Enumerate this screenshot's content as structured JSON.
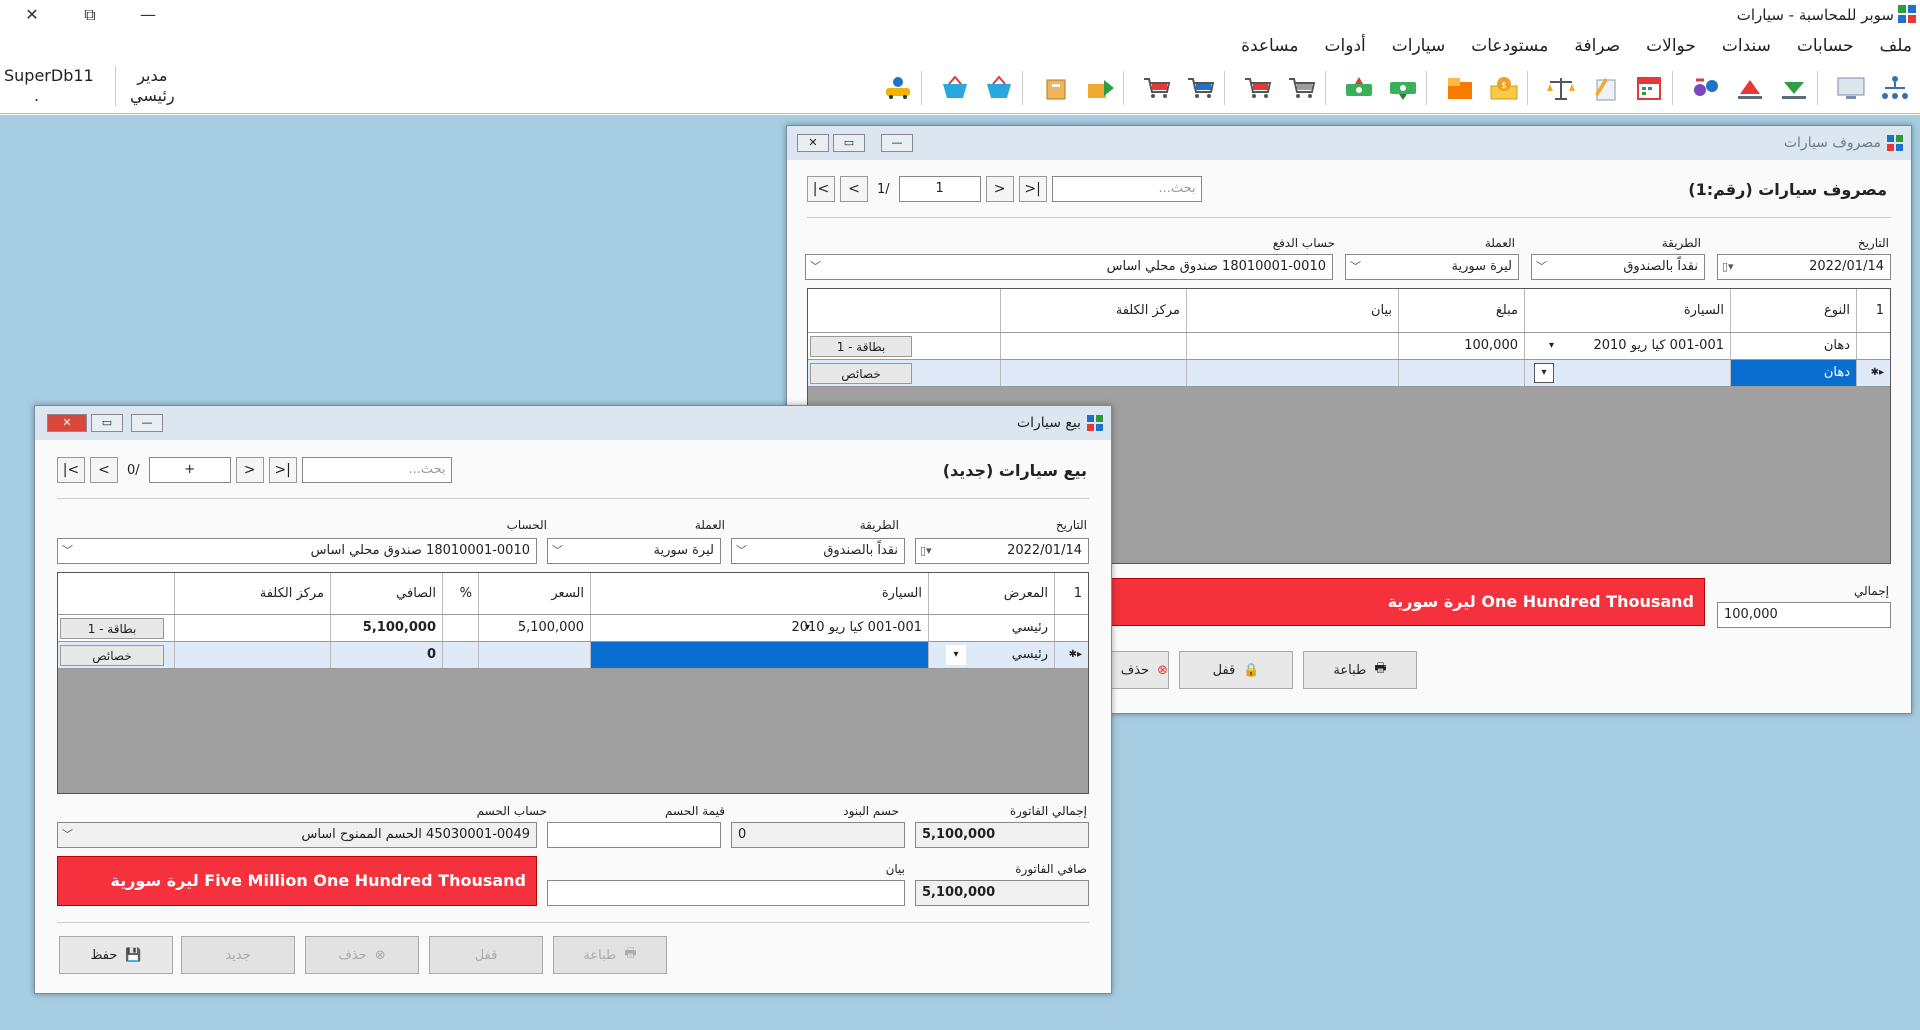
{
  "app": {
    "title": "سوبر للمحاسبة - سيارات",
    "user_db": "SuperDb11",
    "user_db_dot": ".",
    "user_role_1": "مدير",
    "user_role_2": "رئيسي"
  },
  "menu": [
    "ملف",
    "حسابات",
    "سندات",
    "حوالات",
    "صرافة",
    "مستودعات",
    "سيارات",
    "أدوات",
    "مساعدة"
  ],
  "toolbar_icons": [
    "hierarchy-icon",
    "monitor-icon",
    "arrow-down-icon",
    "arrow-up-icon",
    "exchange-icon",
    "calendar-icon",
    "pen-icon",
    "scale-icon",
    "coin-envelope-icon",
    "orange-box-icon",
    "cash-in-icon",
    "cash-out-icon",
    "cart-1-icon",
    "cart-2-icon",
    "cart-3-icon",
    "cart-4-icon",
    "box-arrow-icon",
    "box-icon",
    "basket-1-icon",
    "basket-2-icon",
    "car-user-icon"
  ],
  "expense_win": {
    "title": "مصروف سيارات",
    "header": "مصروف سيارات (رقم:1)",
    "search_ph": "بحث...",
    "page": "1",
    "of": "1/",
    "labels": {
      "date": "التاريخ",
      "method": "الطريقة",
      "currency": "العملة",
      "payacc": "حساب الدفع"
    },
    "date": "2022/01/14",
    "method": "نقداً بالصندوق",
    "currency": "ليرة سورية",
    "payacc": "18010001-0010 صندوق محلي اساس",
    "cols": {
      "n": "1",
      "type": "النوع",
      "car": "السيارة",
      "amount": "مبلغ",
      "desc": "بيان",
      "cost": "مركز الكلفة"
    },
    "rows": [
      {
        "type": "دهان",
        "car": "001-001 كيا ريو 2010",
        "amount": "100,000",
        "btn": "بطاقة - 1"
      },
      {
        "type": "دهان",
        "car": "",
        "amount": "",
        "btn": "خصائص"
      }
    ],
    "total_label": "إجمالي",
    "total": "100,000",
    "total_words": "One Hundred  Thousand  ليرة سورية",
    "btns": {
      "print": "طباعة",
      "lock": "قفل",
      "del": "حذف"
    }
  },
  "sale_win": {
    "title": "بيع سيارات",
    "header": "بيع سيارات (جديد)",
    "search_ph": "بحث...",
    "page": "+",
    "of": "0/",
    "labels": {
      "date": "التاريخ",
      "method": "الطريقة",
      "currency": "العملة",
      "account": "الحساب"
    },
    "date": "2022/01/14",
    "method": "نقداً بالصندوق",
    "currency": "ليرة سورية",
    "account": "18010001-0010 صندوق محلي اساس",
    "cols": {
      "n": "1",
      "showroom": "المعرض",
      "car": "السيارة",
      "price": "السعر",
      "pct": "%",
      "net": "الصافي",
      "cost": "مركز الكلفة"
    },
    "rows": [
      {
        "showroom": "رئيسي",
        "car": "001-001 كيا ريو 2010",
        "price": "5,100,000",
        "net": "5,100,000",
        "btn": "بطاقة - 1"
      },
      {
        "showroom": "رئيسي",
        "car": "",
        "price": "",
        "net": "0",
        "btn": "خصائص"
      }
    ],
    "foot_labels": {
      "inv_total": "إجمالي الفاتورة",
      "items_disc": "حسم البنود",
      "disc_value": "قيمة الحسم",
      "disc_acc": "حساب الحسم",
      "net": "صافي الفاتورة",
      "desc": "بيان"
    },
    "inv_total": "5,100,000",
    "items_disc": "0",
    "disc_value": "",
    "disc_acc": "45030001-0049 الحسم الممنوح اساس",
    "net": "5,100,000",
    "total_words": "Five Million One Hundred  Thousand  ليرة سورية",
    "btns": {
      "save": "حفظ",
      "new": "جديد",
      "del": "حذف",
      "lock": "قفل",
      "print": "طباعة"
    }
  }
}
